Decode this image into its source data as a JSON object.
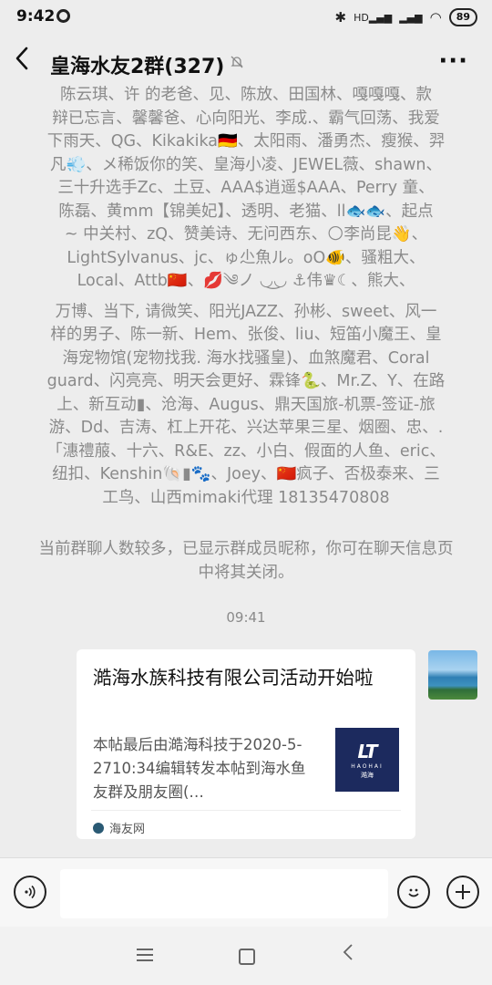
{
  "status_bar": {
    "time": "9:42",
    "network_label": "HD",
    "battery": "89"
  },
  "nav": {
    "title": "皇海水友2群(327)",
    "more": "···"
  },
  "notice": {
    "lines": [
      "陈云琪、许 的老爸、见、陈放、田国林、嘎嘎嘎、款",
      "辩已忘言、馨馨爸、心向阳光、李成.、霸气回荡、我爱",
      "下雨天、QG、Kikakika🇩🇪、太阳雨、潘勇杰、瘦猴、羿",
      "凡💨、メ稀饭你的笑、皇海小凌、JEWEL薇、shawn、",
      "三十升选手Zc、土豆、AAA$逍遥$AAA、Perry 童、",
      "陈磊、黄mm【锦美妃】、透明、老猫、ll🐟🐟、起点",
      "~ 中关村、zQ、赞美诗、无问西东、🌕李尚昆👋、",
      "LightSylvanus、jc、ゅ尐魚ル。oO🐠、骚粗大、",
      "Local、Attb🇨🇳、💋༄ノ ◡͜◡ ⚓伟♛☾、熊大、",
      "万博、当下, 请微笑、阳光JAZZ、孙彬、sweet、风一",
      "样的男子、陈一新、Hem、张俊、liu、短笛小魔王、皇",
      "海宠物馆(宠物找我. 海水找骚皇)、血煞魔君、Coral",
      "guard、闪亮亮、明天会更好、霖锋🐍、Mr.Z、Y、在路",
      "上、新互动▮、沧海、Augus、鼎天国旅-机票-签证-旅",
      "游、Dd、吉涛、杠上开花、兴达苹果三星、烟圈、忠、.",
      "「潓禮菔、十六、R&E、zz、小白、假面的人鱼、eric、",
      "纽扣、Kenshin🐚▮🐾、Joey、🇨🇳疯子、否极泰来、三",
      "工鸟、山西mimaki代理 18135470808"
    ],
    "hint": "当前群聊人数较多，已显示群成员昵称，你可在聊天信息页中将其关闭。"
  },
  "timestamp": "09:41",
  "message": {
    "title": "澔海水族科技有限公司活动开始啦",
    "description": "本帖最后由澔海科技于2020-5-2710:34编辑转发本帖到海水鱼友群及朋友圈(…",
    "thumb_logo": "LT",
    "thumb_sub": "HAOHAI",
    "thumb_cn": "澔海",
    "source": "海友网"
  },
  "icons": {
    "back": "back-arrow-icon",
    "mute": "mute-bell-icon",
    "more": "more-dots-icon",
    "voice": "voice-icon",
    "emoji": "emoji-icon",
    "plus": "plus-icon"
  }
}
